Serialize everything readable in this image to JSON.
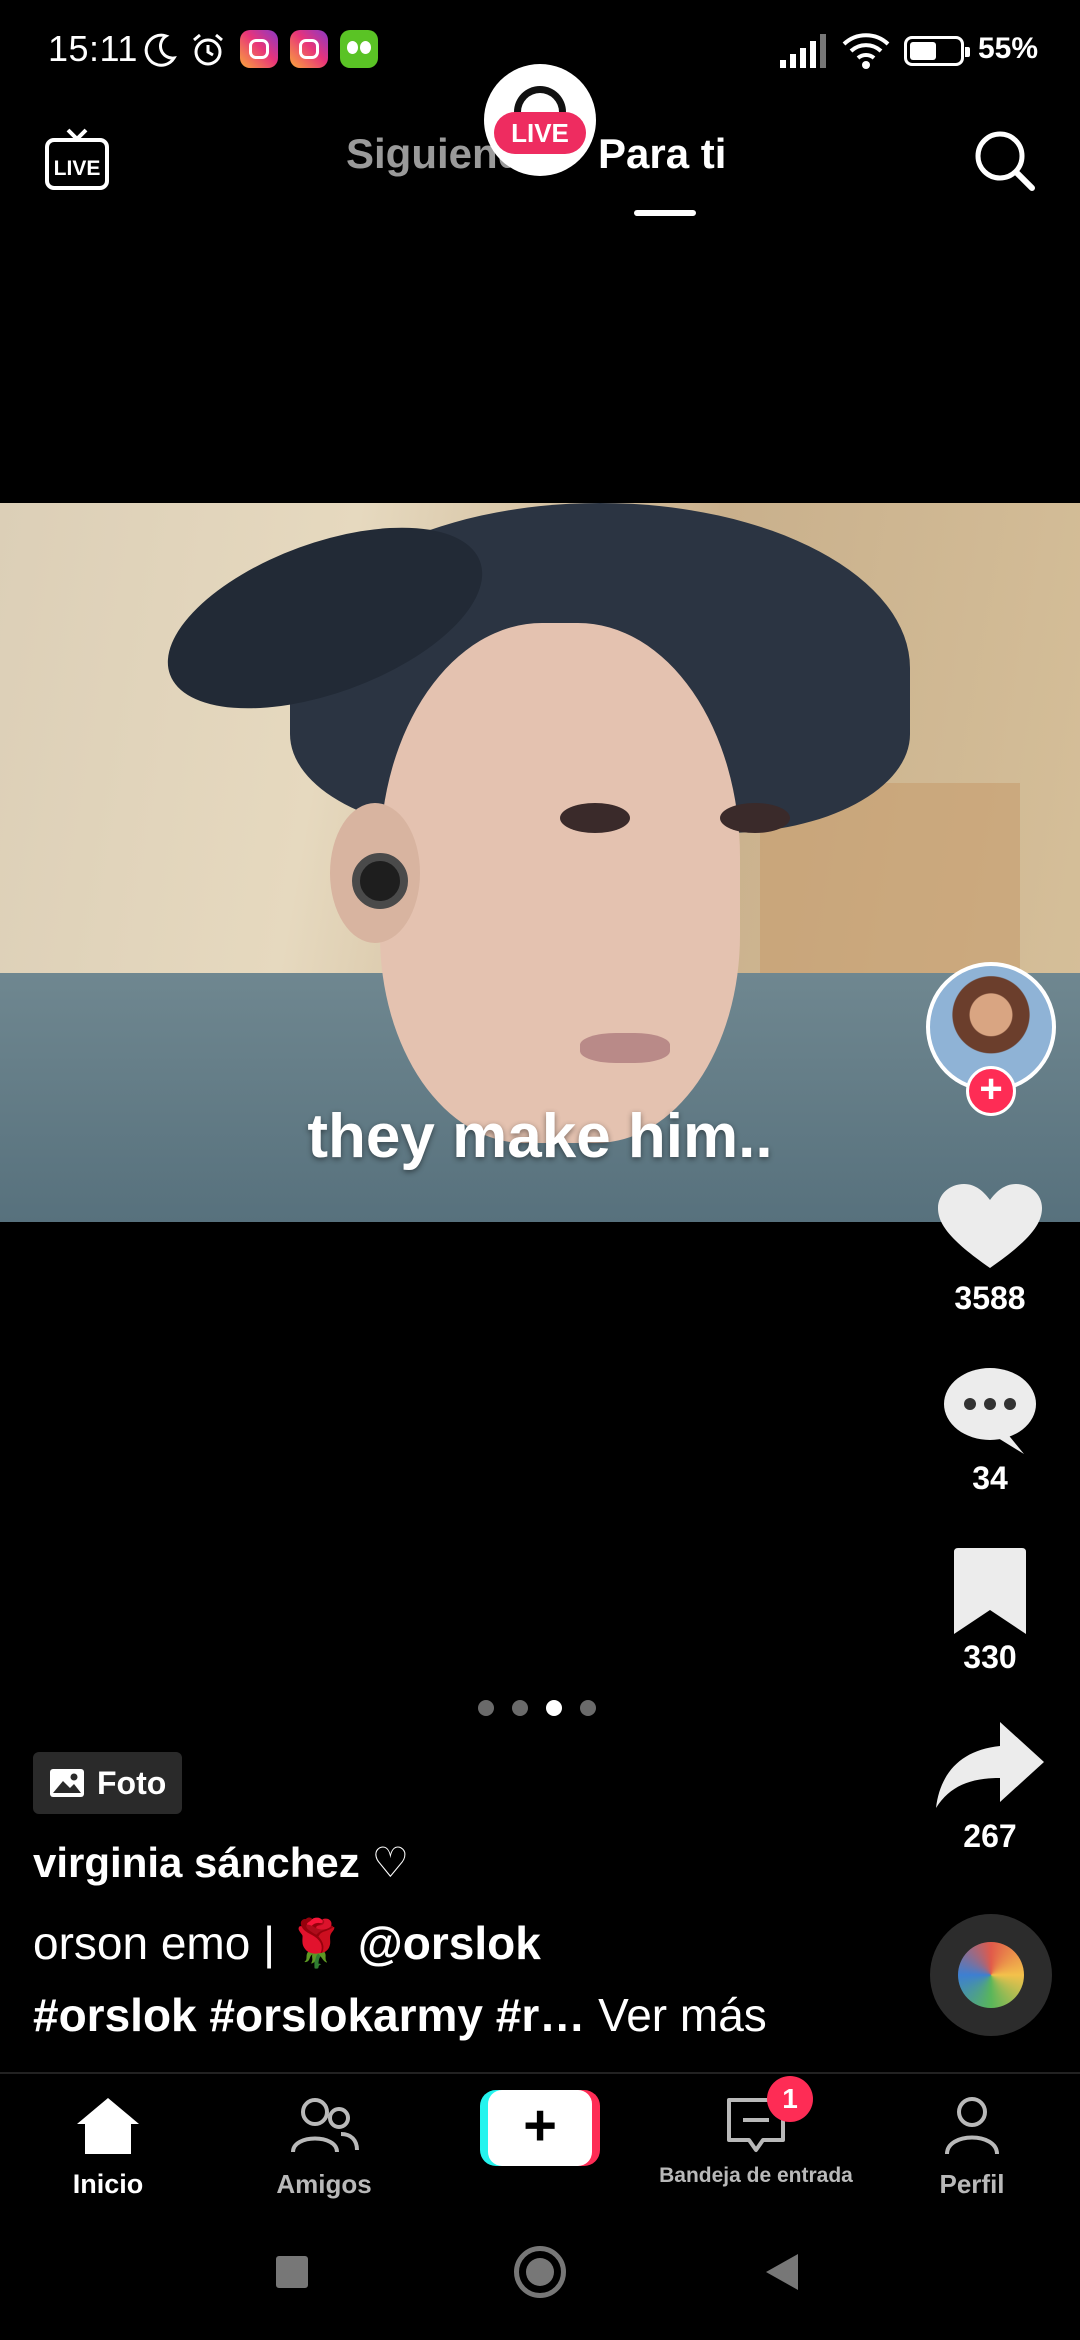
{
  "status_bar": {
    "time": "15:11",
    "battery_text": "55%",
    "battery_level": 0.55,
    "icons": [
      "moon-icon",
      "alarm-icon",
      "instagram-icon",
      "instagram-icon",
      "duolingo-icon",
      "signal-icon",
      "wifi-icon",
      "battery-icon"
    ]
  },
  "top_nav": {
    "live_button_label": "LIVE",
    "live_bubble_label": "LIVE",
    "tab_following": "Siguiendo",
    "tab_foryou": "Para ti",
    "active_tab": "Para ti"
  },
  "post": {
    "type_label": "Foto",
    "image_caption": "they make him..",
    "username": "virginia sánchez ♡",
    "description_text": "orson emo | 🌹 ",
    "mention": "@orslok",
    "hashtags_text": "#orslok #orslokarmy #r…",
    "see_more": "Ver más",
    "likes": "3588",
    "comments": "34",
    "saves": "330",
    "shares": "267",
    "carousel_total": 4,
    "carousel_active": 3
  },
  "bottom_nav": {
    "home": "Inicio",
    "friends": "Amigos",
    "create_symbol": "+",
    "inbox": "Bandeja de entrada",
    "inbox_badge": "1",
    "profile": "Perfil",
    "active": "Inicio"
  },
  "colors": {
    "accent_red": "#fe2c55",
    "accent_cyan": "#25f4ee",
    "background": "#000000",
    "inactive_text": "#9a9a9a"
  }
}
